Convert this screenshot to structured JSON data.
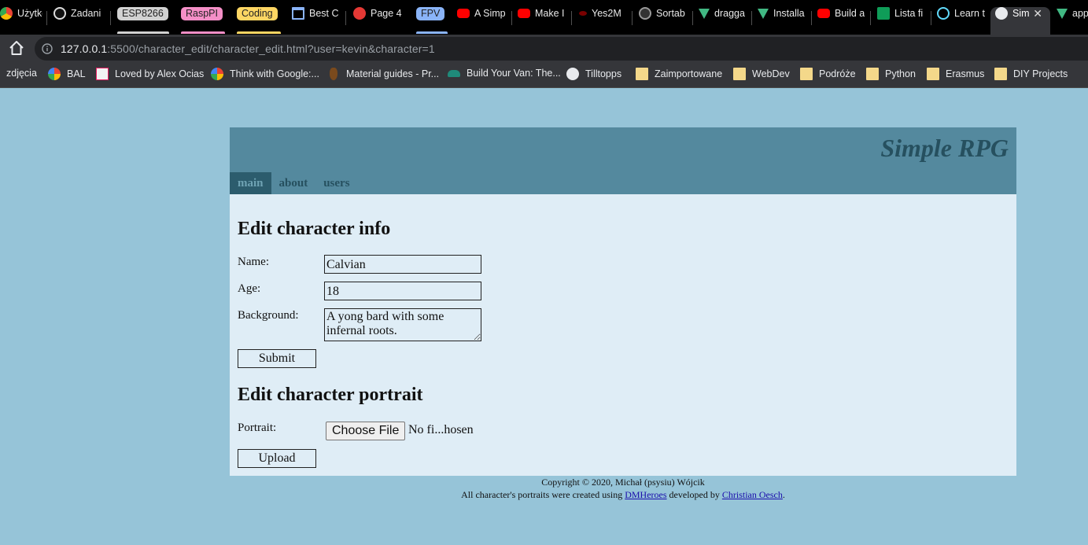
{
  "browser": {
    "tabs": [
      {
        "label": "Użytko",
        "icon": "chrome-icon"
      },
      {
        "label": "Zadani",
        "icon": "compass-icon"
      },
      {
        "label": "ESP8266",
        "group": true,
        "color": "#d2d2d2",
        "text_color": "#222222"
      },
      {
        "label": "RaspPI",
        "group": true,
        "color": "#f58fc7",
        "text_color": "#222222"
      },
      {
        "label": "Coding",
        "group": true,
        "color": "#fdd663",
        "text_color": "#222222"
      },
      {
        "label": "Best C",
        "icon": "bank-icon"
      },
      {
        "label": "Page 4",
        "icon": "pin-icon"
      },
      {
        "label": "FPV",
        "group": true,
        "color": "#8ab4f8",
        "text_color": "#222222"
      },
      {
        "label": "A Simp",
        "icon": "youtube-icon"
      },
      {
        "label": "Make I",
        "icon": "youtube-icon"
      },
      {
        "label": "Yes2M",
        "icon": "red-wave-icon"
      },
      {
        "label": "Sortab",
        "icon": "github-icon"
      },
      {
        "label": "dragga",
        "icon": "vue-icon"
      },
      {
        "label": "Installa",
        "icon": "vue-icon"
      },
      {
        "label": "Build a",
        "icon": "youtube-icon"
      },
      {
        "label": "Lista fi",
        "icon": "sheets-icon"
      },
      {
        "label": "Learn t",
        "icon": "react-icon"
      },
      {
        "label": "Sim",
        "icon": "globe-icon",
        "active": true
      },
      {
        "label": "app",
        "icon": "vue-icon"
      }
    ],
    "url_host": "127.0.0.1",
    "url_rest": ":5500/character_edit/character_edit.html?user=kevin&character=1",
    "bookmarks": [
      {
        "label": "zdjęcia",
        "icon": "none"
      },
      {
        "label": "BAL",
        "icon": "google-icon"
      },
      {
        "label": "Loved by Alex Ocias",
        "icon": "alex-icon"
      },
      {
        "label": "Think with Google:...",
        "icon": "google-icon"
      },
      {
        "label": "Material guides - Pr...",
        "icon": "guitar-icon"
      },
      {
        "label": "Build Your Van: The...",
        "icon": "van-icon"
      },
      {
        "label": "Tilltopps",
        "icon": "globe-icon"
      },
      {
        "label": "Zaimportowane",
        "icon": "folder-icon"
      },
      {
        "label": "WebDev",
        "icon": "folder-icon"
      },
      {
        "label": "Podróże",
        "icon": "folder-icon"
      },
      {
        "label": "Python",
        "icon": "folder-icon"
      },
      {
        "label": "Erasmus",
        "icon": "folder-icon"
      },
      {
        "label": "DIY Projects",
        "icon": "folder-icon"
      }
    ]
  },
  "site": {
    "title": "Simple RPG",
    "nav": [
      "main",
      "about",
      "users"
    ]
  },
  "info_form": {
    "heading": "Edit character info",
    "name_label": "Name:",
    "name_value": "Calvian",
    "age_label": "Age:",
    "age_value": "18",
    "background_label": "Background:",
    "background_value": "A yong bard with some infernal roots.",
    "submit_label": "Submit"
  },
  "portrait_form": {
    "heading": "Edit character portrait",
    "portrait_label": "Portrait:",
    "file_button": "Choose File",
    "file_status": "No fi...hosen",
    "upload_label": "Upload"
  },
  "footer": {
    "copyright": "Copyright © 2020, Michał (psysiu) Wójcik",
    "credit_prefix": "All character's portraits were created using",
    "credit_link1": "DMHeroes",
    "credit_middle": "developed by",
    "credit_link2": "Christian Oesch",
    "credit_suffix": "."
  },
  "colors": {
    "page_bg": "#96c4d8",
    "header_bg": "#54899e",
    "title": "#26505f",
    "nav_active_bg": "#2c5c6d",
    "content_bg": "#dfedf6"
  }
}
